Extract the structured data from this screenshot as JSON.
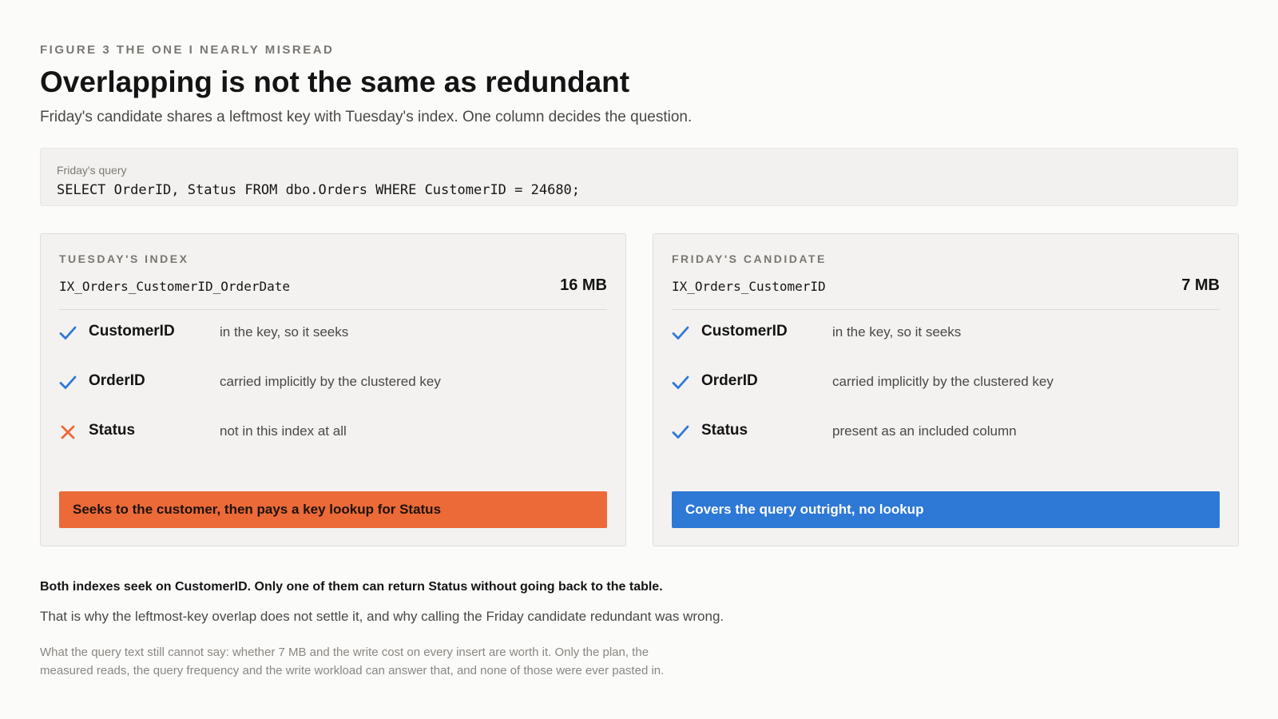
{
  "header": {
    "eyebrow": "FIGURE 3  THE ONE I NEARLY MISREAD",
    "title": "Overlapping is not the same as redundant",
    "subtitle": "Friday's candidate shares a leftmost key with Tuesday's index. One column decides the question."
  },
  "query": {
    "label": "Friday's query",
    "code": "SELECT OrderID, Status FROM dbo.Orders WHERE CustomerID = 24680;"
  },
  "cards": [
    {
      "label": "TUESDAY'S INDEX",
      "index_name": "IX_Orders_CustomerID_OrderDate",
      "size": "16 MB",
      "rows": [
        {
          "status": "check",
          "column": "CustomerID",
          "note": "in the key, so it seeks"
        },
        {
          "status": "check",
          "column": "OrderID",
          "note": "carried implicitly by the clustered key"
        },
        {
          "status": "cross",
          "column": "Status",
          "note": "not in this index at all"
        }
      ],
      "verdict": "Seeks to the customer, then pays a key lookup for Status"
    },
    {
      "label": "FRIDAY'S CANDIDATE",
      "index_name": "IX_Orders_CustomerID",
      "size": "7 MB",
      "rows": [
        {
          "status": "check",
          "column": "CustomerID",
          "note": "in the key, so it seeks"
        },
        {
          "status": "check",
          "column": "OrderID",
          "note": "carried implicitly by the clustered key"
        },
        {
          "status": "check",
          "column": "Status",
          "note": "present as an included column"
        }
      ],
      "verdict": "Covers the query outright, no lookup"
    }
  ],
  "footer": {
    "conclusion": "Both indexes seek on CustomerID. Only one of them can return Status without going back to the table.",
    "explain": "That is why the leftmost-key overlap does not settle it, and why calling the Friday candidate redundant was wrong.",
    "caveat": "What the query text still cannot say: whether 7 MB and the write cost on every insert are worth it. Only the plan, the measured reads, the query frequency and the write workload can answer that, and none of those were ever pasted in."
  },
  "colors": {
    "check": "#2e78d6",
    "cross": "#ec6a37",
    "verdict_bad": "#ec6a37",
    "verdict_good": "#2e78d6"
  }
}
